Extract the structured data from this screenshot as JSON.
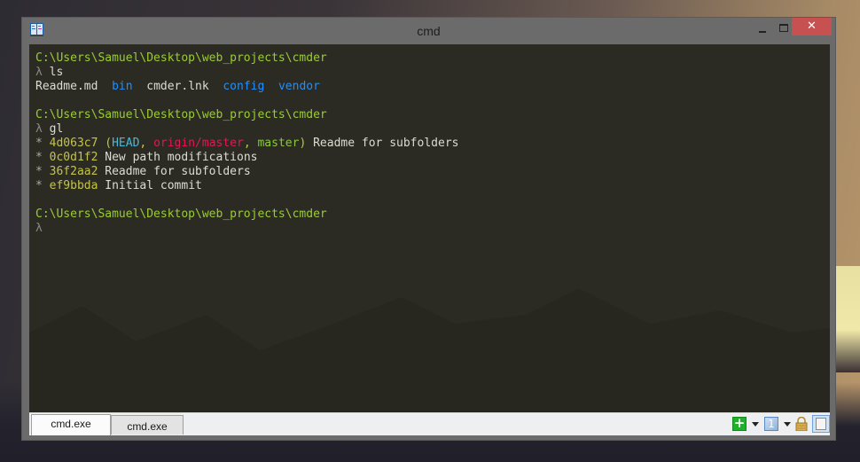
{
  "window": {
    "title": "cmd",
    "close_glyph": "✕",
    "icons": {
      "app": "cmder-app-icon",
      "minimize": "minimize-icon",
      "maximize": "maximize-icon",
      "close": "close-icon"
    }
  },
  "terminal": {
    "colors": {
      "background": "#2b2b24",
      "path": "#9acd32",
      "directory": "#1e90ff",
      "hash": "#c4c44a",
      "head": "#4ab8d8",
      "remote_branch": "#e0194e",
      "local_branch": "#8cc83c"
    },
    "prompt_symbol": "λ",
    "blocks": [
      {
        "path": "C:\\Users\\Samuel\\Desktop\\web_projects\\cmder",
        "command": "ls",
        "ls_items": [
          {
            "name": "Readme.md",
            "type": "file"
          },
          {
            "name": "bin",
            "type": "dir"
          },
          {
            "name": "cmder.lnk",
            "type": "file"
          },
          {
            "name": "config",
            "type": "dir"
          },
          {
            "name": "vendor",
            "type": "dir"
          }
        ]
      },
      {
        "path": "C:\\Users\\Samuel\\Desktop\\web_projects\\cmder",
        "command": "gl",
        "commits": [
          {
            "star": "*",
            "hash": "4d063c7",
            "refs_open": "(",
            "head": "HEAD",
            "sep1": ", ",
            "remote": "origin/master",
            "sep2": ", ",
            "branch": "master",
            "refs_close": ")",
            "message": "Readme for subfolders"
          },
          {
            "star": "*",
            "hash": "0c0d1f2",
            "message": "New path modifications"
          },
          {
            "star": "*",
            "hash": "36f2aa2",
            "message": "Readme for subfolders"
          },
          {
            "star": "*",
            "hash": "ef9bbda",
            "message": "Initial commit"
          }
        ]
      },
      {
        "path": "C:\\Users\\Samuel\\Desktop\\web_projects\\cmder",
        "command": ""
      }
    ]
  },
  "tabs": [
    {
      "label": "cmd.exe",
      "active": true
    },
    {
      "label": "cmd.exe",
      "active": false
    }
  ],
  "toolbar": {
    "add_glyph": "+",
    "console_number": "1",
    "icons": [
      "add-console-icon",
      "dropdown-icon",
      "console-list-icon",
      "dropdown-icon",
      "lock-icon",
      "split-view-icon"
    ]
  }
}
